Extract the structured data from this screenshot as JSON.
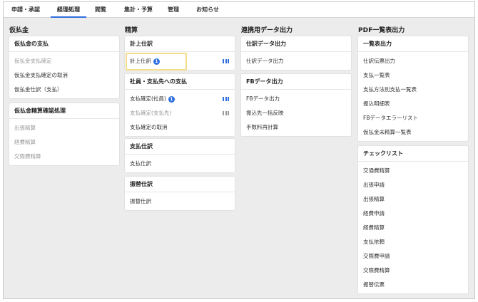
{
  "nav": {
    "tabs": [
      {
        "label": "申請・承認"
      },
      {
        "label": "経理処理"
      },
      {
        "label": "閲覧"
      },
      {
        "label": "集計・予算"
      },
      {
        "label": "管理"
      },
      {
        "label": "お知らせ"
      }
    ],
    "active_index": 1
  },
  "columns": {
    "karibarai": {
      "title": "仮払金",
      "cards": [
        {
          "head": "仮払金の支払",
          "items": [
            {
              "label": "仮払金支払確定"
            },
            {
              "label": "仮払金支払確定の取消"
            },
            {
              "label": "仮払金仕訳（支払）"
            }
          ]
        },
        {
          "head": "仮払金精算確認処理",
          "items": [
            {
              "label": "出張精算"
            },
            {
              "label": "経費精算"
            },
            {
              "label": "交際費精算"
            }
          ]
        }
      ]
    },
    "seisan": {
      "title": "精算",
      "cards": [
        {
          "head": "計上仕訳",
          "items": [
            {
              "label": "計上仕訳",
              "badge": "1"
            }
          ]
        },
        {
          "head": "社員・支払先への支払",
          "items": [
            {
              "label": "支払確定(社員)",
              "badge": "1"
            },
            {
              "label": "支払確定(支払先)"
            },
            {
              "label": "支払確定の取消"
            }
          ]
        },
        {
          "head": "支払仕訳",
          "items": [
            {
              "label": "支払仕訳"
            }
          ]
        },
        {
          "head": "振替仕訳",
          "items": [
            {
              "label": "振替仕訳"
            }
          ]
        }
      ]
    },
    "renkei": {
      "title": "連携用データ出力",
      "cards": [
        {
          "head": "仕訳データ出力",
          "items": [
            {
              "label": "仕訳データ出力"
            }
          ]
        },
        {
          "head": "FBデータ出力",
          "items": [
            {
              "label": "FBデータ出力"
            },
            {
              "label": "振込先一括反映"
            },
            {
              "label": "手数料再計算"
            }
          ]
        }
      ]
    },
    "pdf": {
      "title": "PDF一覧表出力",
      "cards": [
        {
          "head": "一覧表出力",
          "items": [
            {
              "label": "仕訳伝票出力"
            },
            {
              "label": "支払一覧表"
            },
            {
              "label": "支払方法別支払一覧表"
            },
            {
              "label": "振込明細表"
            },
            {
              "label": "FBデータエラーリスト"
            },
            {
              "label": "仮払金未精算一覧表"
            }
          ]
        },
        {
          "head": "チェックリスト",
          "items": [
            {
              "label": "交通費精算"
            },
            {
              "label": "出張申請"
            },
            {
              "label": "出張精算"
            },
            {
              "label": "経費申請"
            },
            {
              "label": "経費精算"
            },
            {
              "label": "支払依頼"
            },
            {
              "label": "交際費申請"
            },
            {
              "label": "交際費精算"
            },
            {
              "label": "振替伝票"
            }
          ]
        }
      ]
    }
  },
  "colors": {
    "accent": "#2f6fe0",
    "highlight": "#f4dc8a",
    "disabled_text": "#9a9a9a"
  }
}
